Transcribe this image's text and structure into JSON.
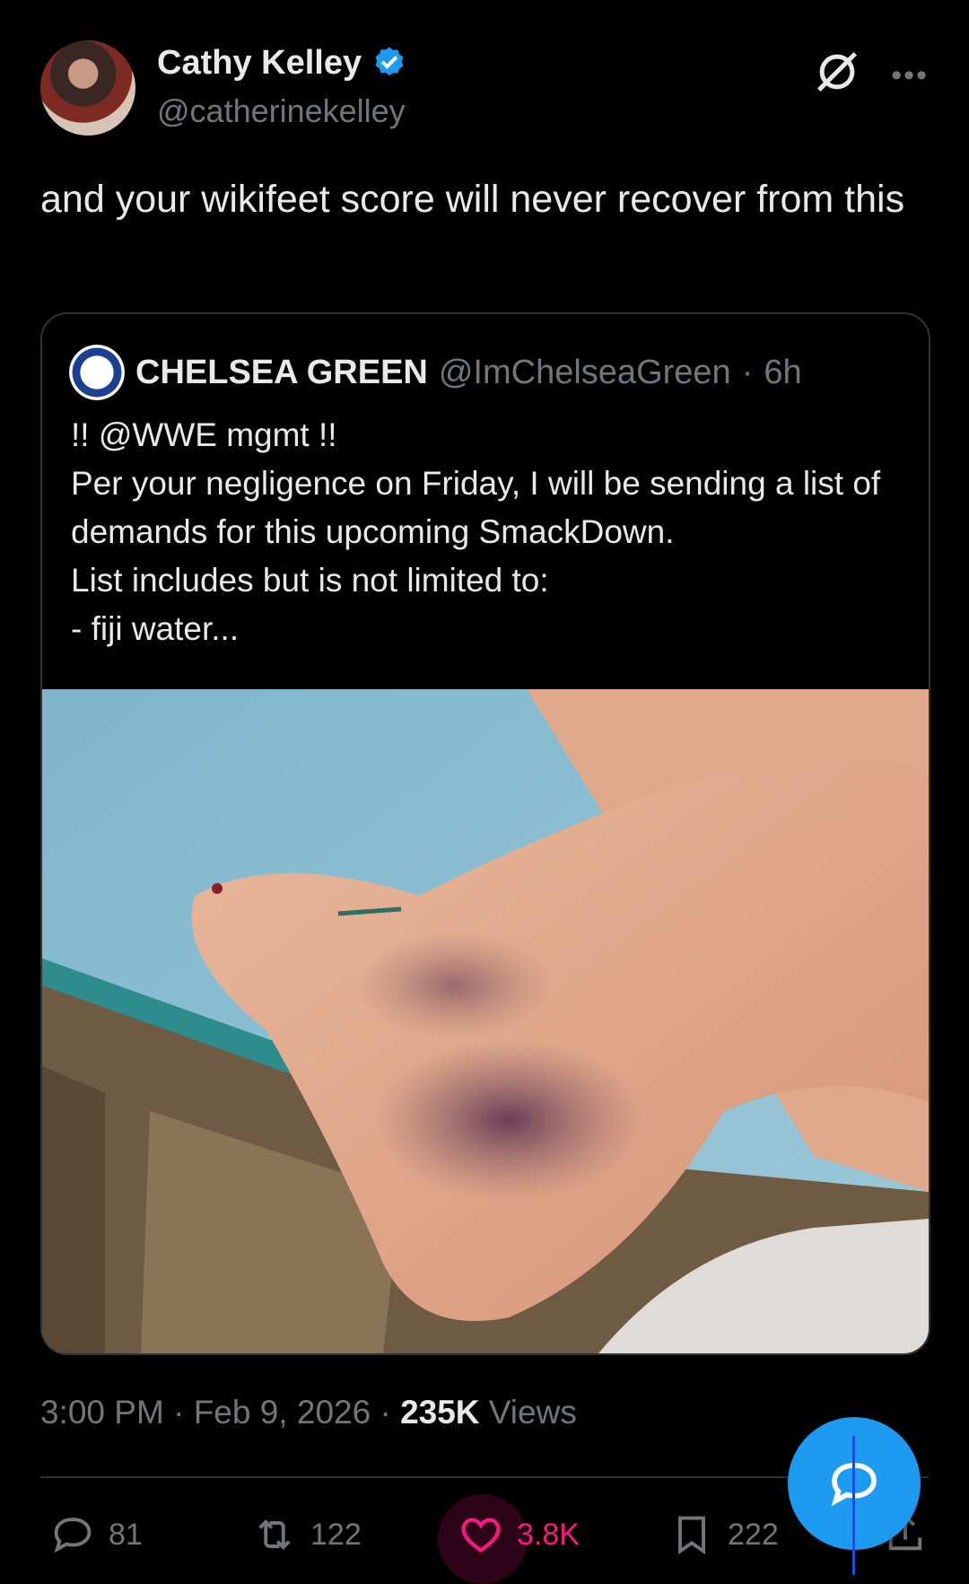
{
  "author": {
    "display_name": "Cathy Kelley",
    "handle": "@catherinekelley",
    "verified": true,
    "verified_color": "#1d9bf0"
  },
  "tweet": {
    "text": "and your wikifeet score will never recover from this",
    "time": "3:00 PM",
    "date": "Feb 9, 2026",
    "views_count": "235K",
    "views_label": "Views"
  },
  "quote": {
    "display_name": "CHELSEA GREEN",
    "handle": "@ImChelseaGreen",
    "age": "6h",
    "text": "!! @WWE mgmt !!\nPer your negligence on Friday, I will be sending a list of demands for this upcoming SmackDown.\nList includes but is not limited to:\n- fiji water..."
  },
  "actions": {
    "replies": "81",
    "reposts": "122",
    "likes": "3.8K",
    "bookmarks": "222",
    "like_color": "#f91880"
  },
  "icons": [
    "verified-badge-icon",
    "grok-icon",
    "more-icon",
    "reply-icon",
    "repost-icon",
    "like-icon",
    "bookmark-icon",
    "share-icon",
    "compose-reply-icon"
  ]
}
